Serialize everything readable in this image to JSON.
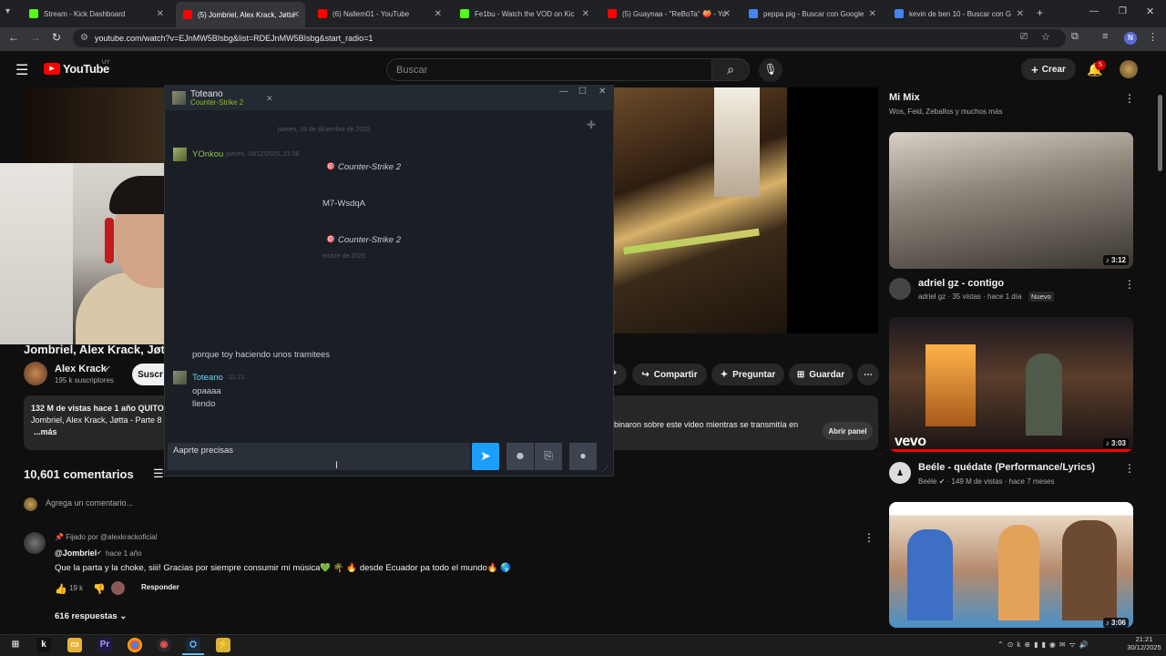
{
  "browser": {
    "tabs": [
      {
        "title": "Stream - Kick Dashboard",
        "color": "#53fc18"
      },
      {
        "title": "(5) Jombriel, Alex Krack, Jøtta -",
        "color": "#ff0000"
      },
      {
        "title": "(6) Nallem01 - YouTube",
        "color": "#ff0000"
      },
      {
        "title": "Fe1bu - Watch the VOD on Kic",
        "color": "#53fc18"
      },
      {
        "title": "(5) Guaynaa - \"ReBoTa\" 🍑 - Yo",
        "color": "#ff0000"
      },
      {
        "title": "peppa pig - Buscar con Google",
        "color": "#4285f4"
      },
      {
        "title": "kevin de ben 10 - Buscar con G",
        "color": "#4285f4"
      }
    ],
    "url": "youtube.com/watch?v=EJnMW5BIsbg&list=RDEJnMW5BIsbg&start_radio=1",
    "profile_initial": "N"
  },
  "youtube": {
    "logo": "YouTube",
    "region": "UY",
    "search_placeholder": "Buscar",
    "create_label": "Crear",
    "notif_count": "5",
    "video_title": "Jombriel, Alex Krack, Jøtt",
    "channel_name": "Alex Krack",
    "subscribers": "195 k suscriptores",
    "subscribe_label": "Suscr",
    "share_label": "Compartir",
    "ask_label": "Preguntar",
    "save_label": "Guardar",
    "desc_stats": "132 M de vistas  hace 1 año  QUITO",
    "desc_line": "Jombriel, Alex Krack, Jøtta - Parte 8",
    "desc_more": "...más",
    "live_chat_text": "binaron sobre este video mientras se transmitía en",
    "open_panel": "Abrir panel",
    "comments_count": "10,601 comentarios",
    "add_comment": "Agrega un comentario...",
    "pinned": {
      "pinned_by": "Fijado por @alexkrackoficial",
      "author": "@Jombriel",
      "time": "hace 1 año",
      "text": "Que la parta y la choke, siii! Gracias por siempre consumir mi música💚 🌴 🔥 desde Ecuador pa todo el mundo🔥 🌎",
      "likes": "19 k",
      "reply_label": "Responder",
      "replies": "616 respuestas"
    }
  },
  "mix": {
    "title": "Mi Mix",
    "subtitle": "Wos, Feid, Zeballos y muchos más",
    "videos": [
      {
        "title": "adriel gz - contigo",
        "channel": "adriel gz",
        "meta": "35 vistas · hace 1 día",
        "badge": "Nuevo",
        "duration": "3:12"
      },
      {
        "title": "Beéle - quédate (Performance/Lyrics)",
        "channel": "Beéle",
        "meta": "149 M de vistas · hace 7 meses",
        "badge": "",
        "duration": "3:03",
        "brand": "vevo"
      },
      {
        "title": "",
        "channel": "",
        "meta": "",
        "badge": "",
        "duration": "3:06"
      }
    ]
  },
  "steam_chat": {
    "contact": "Toteano",
    "game": "Counter-Strike 2",
    "date_divider": "jueves, 18 de diciembre de 2025",
    "friend": "YOnkou",
    "friend_time": "jueves, 18/12/2025, 21:36",
    "game_invite_1": "Counter-Strike 2",
    "invite_code": "M7-WsdqA",
    "game_invite_2": "Counter-Strike 2",
    "date_divider_2": "embre de 2025",
    "message_prev": "porque toy haciendo unos tramitees",
    "author": "Toteano",
    "author_time": "21:21",
    "messages": [
      "opaaaa",
      "llendo"
    ],
    "input_value": "Aaprte precisas"
  },
  "taskbar": {
    "time": "21:21",
    "date": "30/12/2025"
  }
}
